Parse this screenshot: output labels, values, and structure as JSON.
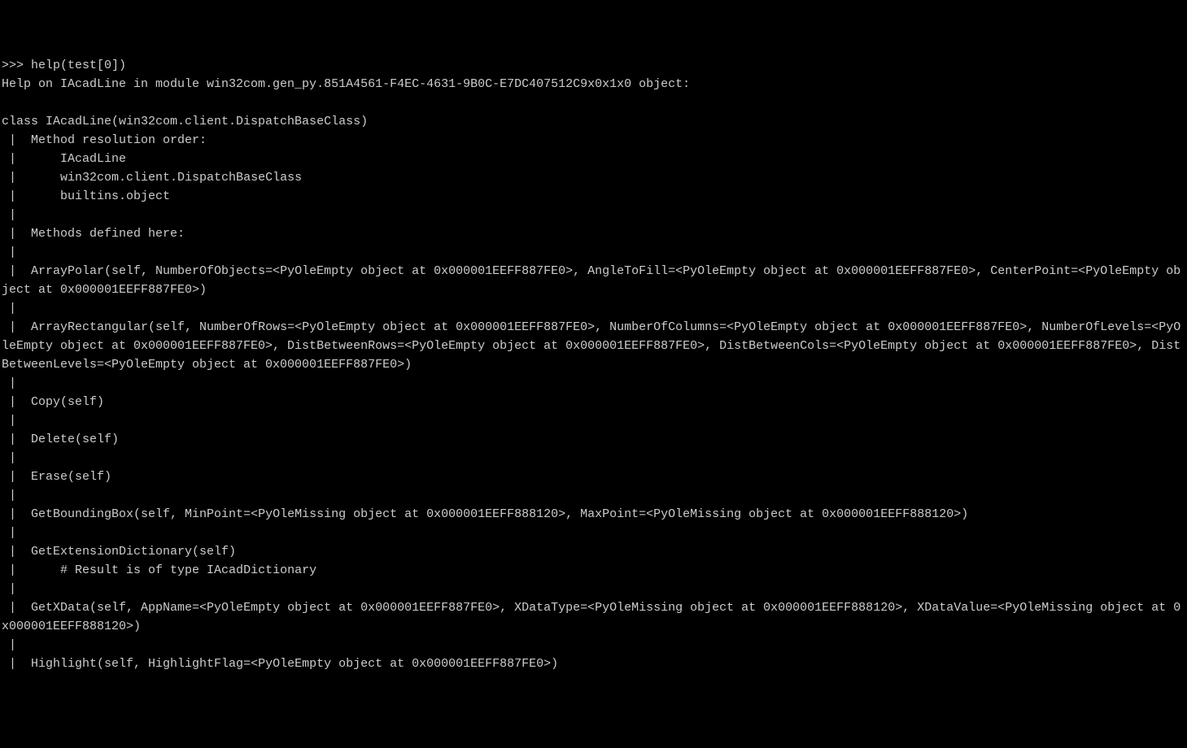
{
  "prompt": ">>> ",
  "command": "help(test[0])",
  "help_header": "Help on IAcadLine in module win32com.gen_py.851A4561-F4EC-4631-9B0C-E7DC407512C9x0x1x0 object:",
  "class_decl": "class IAcadLine(win32com.client.DispatchBaseClass)",
  "mro_header": " |  Method resolution order:",
  "mro_1": " |      IAcadLine",
  "mro_2": " |      win32com.client.DispatchBaseClass",
  "mro_3": " |      builtins.object",
  "methods_header": " |  Methods defined here:",
  "pipe_only": " |  ",
  "m_arraypolar": " |  ArrayPolar(self, NumberOfObjects=<PyOleEmpty object at 0x000001EEFF887FE0>, AngleToFill=<PyOleEmpty object at 0x000001EEFF887FE0>, CenterPoint=<PyOleEmpty object at 0x000001EEFF887FE0>)",
  "m_arrayrect": " |  ArrayRectangular(self, NumberOfRows=<PyOleEmpty object at 0x000001EEFF887FE0>, NumberOfColumns=<PyOleEmpty object at 0x000001EEFF887FE0>, NumberOfLevels=<PyOleEmpty object at 0x000001EEFF887FE0>, DistBetweenRows=<PyOleEmpty object at 0x000001EEFF887FE0>, DistBetweenCols=<PyOleEmpty object at 0x000001EEFF887FE0>, DistBetweenLevels=<PyOleEmpty object at 0x000001EEFF887FE0>)",
  "m_copy": " |  Copy(self)",
  "m_delete": " |  Delete(self)",
  "m_erase": " |  Erase(self)",
  "m_getbb": " |  GetBoundingBox(self, MinPoint=<PyOleMissing object at 0x000001EEFF888120>, MaxPoint=<PyOleMissing object at 0x000001EEFF888120>)",
  "m_getextdict": " |  GetExtensionDictionary(self)",
  "m_getextdict_comment": " |      # Result is of type IAcadDictionary",
  "m_getxdata": " |  GetXData(self, AppName=<PyOleEmpty object at 0x000001EEFF887FE0>, XDataType=<PyOleMissing object at 0x000001EEFF888120>, XDataValue=<PyOleMissing object at 0x000001EEFF888120>)",
  "m_highlight": " |  Highlight(self, HighlightFlag=<PyOleEmpty object at 0x000001EEFF887FE0>)"
}
